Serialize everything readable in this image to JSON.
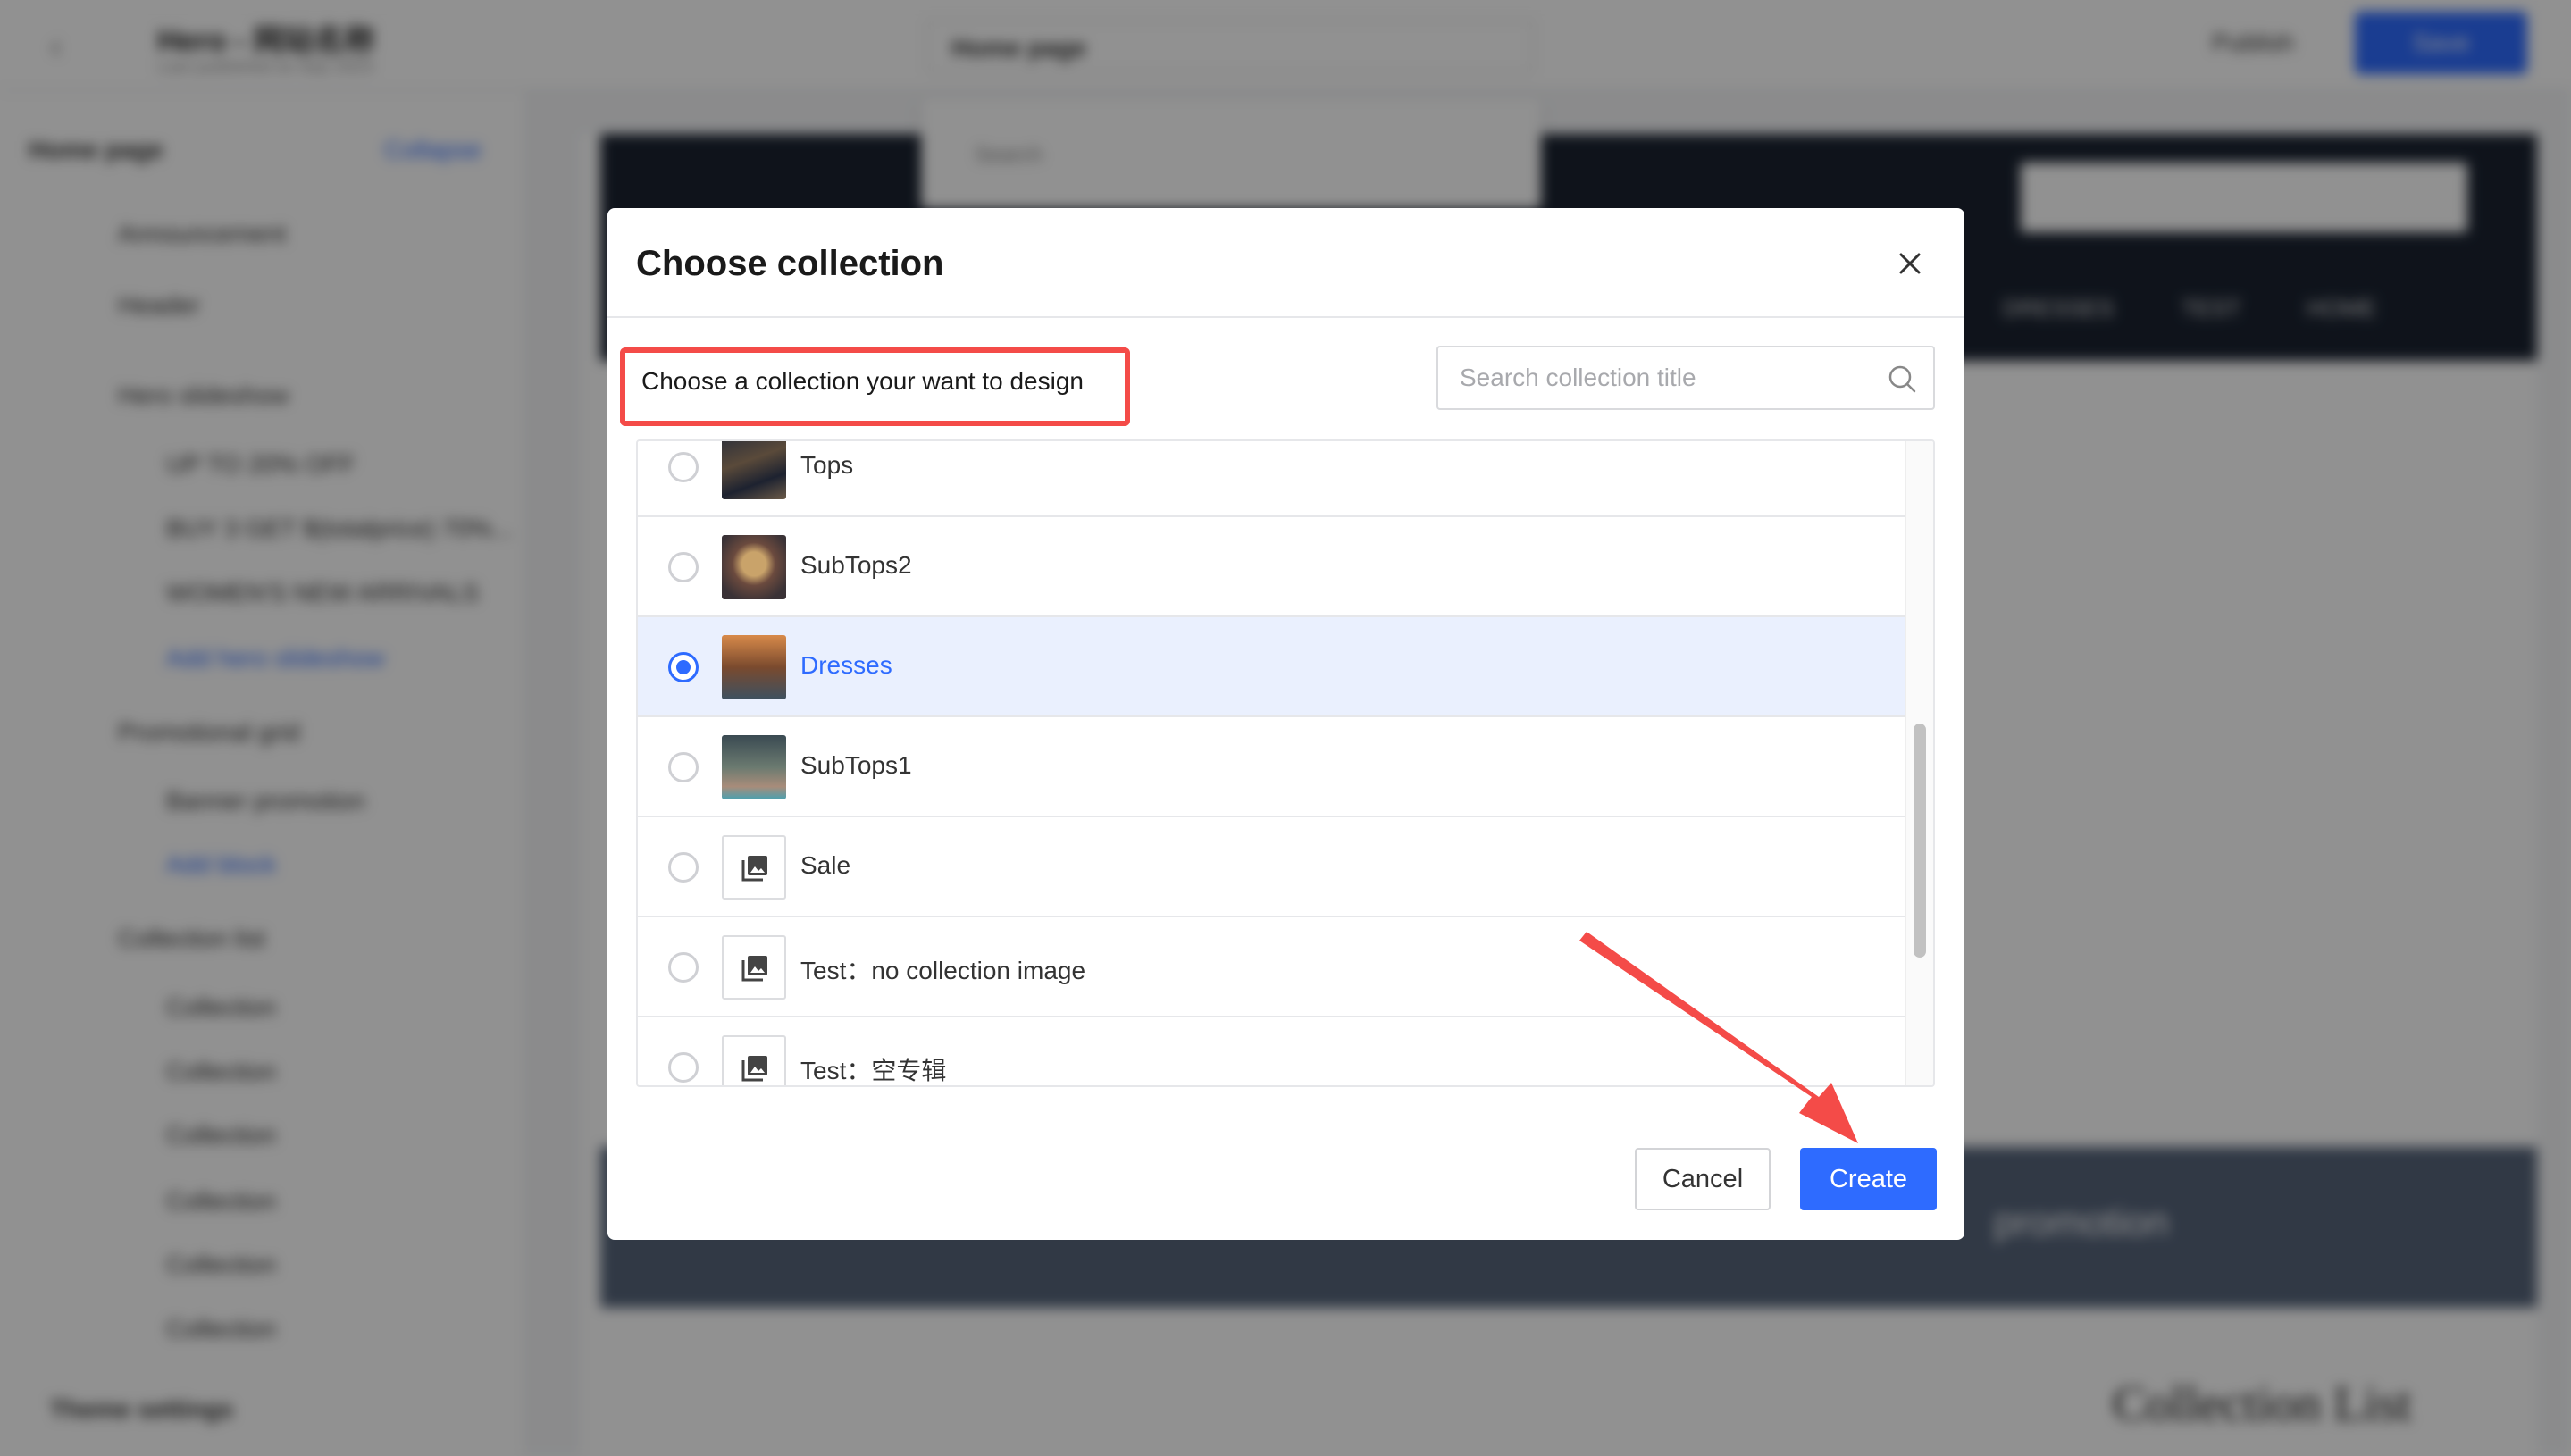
{
  "background": {
    "topbar": {
      "title": "Hero - 网站名称",
      "subtitle": "Last published at Sep 2023",
      "page_select": "Home page",
      "publish_label": "Publish",
      "save_label": "Save"
    },
    "page_dropdown": {
      "search_placeholder": "Search"
    },
    "sidebar": {
      "title": "Home page",
      "collapse_label": "Collapse",
      "items": [
        "Announcement",
        "Header",
        "Hero slideshow",
        "UP TO 20% OFF",
        "BUY 3 GET $(totalprice) 70%...",
        "WOMEN'S NEW ARRIVALS",
        "Add hero slideshow",
        "Promotional grid",
        "Banner promotion",
        "Add block",
        "Collection list",
        "Collection",
        "Collection",
        "Collection",
        "Collection",
        "Collection",
        "Collection"
      ],
      "footer": "Theme settings"
    },
    "canvas": {
      "nav": [
        "DRESSES",
        "TEST",
        "HOME"
      ],
      "promo_text": "promotion",
      "collection_heading": "Collection List"
    }
  },
  "modal": {
    "title": "Choose collection",
    "hint": "Choose a collection your want to design",
    "search_placeholder": "Search collection title",
    "collections": [
      {
        "label": "Tops",
        "selected": false,
        "has_image": true
      },
      {
        "label": "SubTops2",
        "selected": false,
        "has_image": true
      },
      {
        "label": "Dresses",
        "selected": true,
        "has_image": true
      },
      {
        "label": "SubTops1",
        "selected": false,
        "has_image": true
      },
      {
        "label": "Sale",
        "selected": false,
        "has_image": false
      },
      {
        "label": "Test：no collection image",
        "selected": false,
        "has_image": false
      },
      {
        "label": "Test：空专辑",
        "selected": false,
        "has_image": false
      }
    ],
    "cancel_label": "Cancel",
    "create_label": "Create"
  },
  "colors": {
    "primary": "#2e6bff",
    "annotation": "#f44b48",
    "selected_row": "#eaf0fe"
  }
}
